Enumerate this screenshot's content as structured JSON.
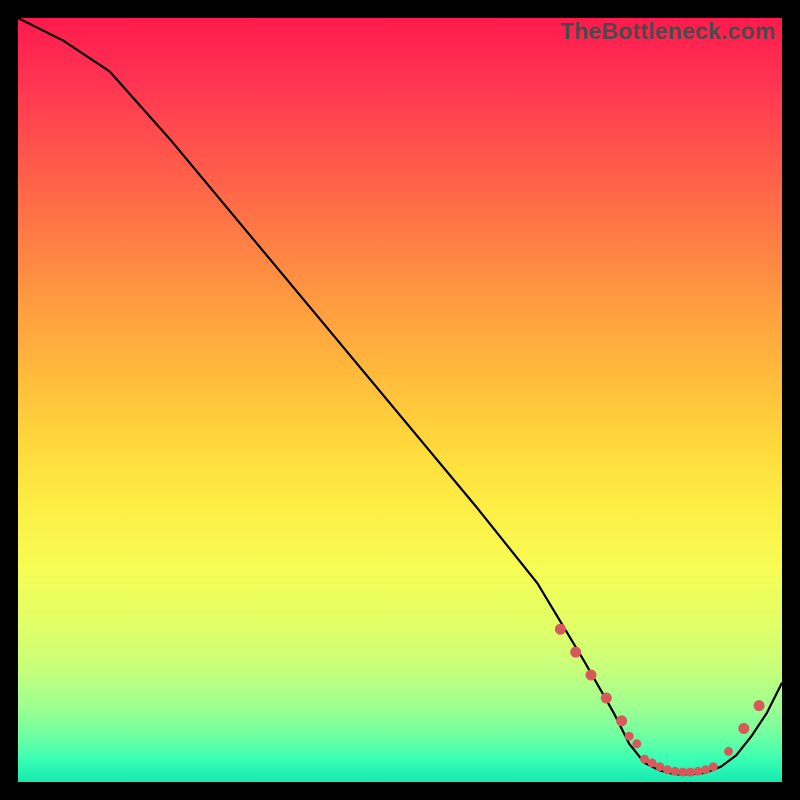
{
  "watermark": "TheBottleneck.com",
  "chart_data": {
    "type": "line",
    "title": "",
    "xlabel": "",
    "ylabel": "",
    "xlim": [
      0,
      100
    ],
    "ylim": [
      0,
      100
    ],
    "series": [
      {
        "name": "curve",
        "x": [
          0,
          6,
          12,
          20,
          30,
          40,
          50,
          60,
          68,
          74,
          78,
          80,
          82,
          84,
          86,
          88,
          90,
          92,
          94,
          96,
          98,
          100
        ],
        "y": [
          100,
          97,
          93,
          84,
          72,
          60,
          48,
          36,
          26,
          16,
          9,
          5,
          2.5,
          1.5,
          1,
          1,
          1.2,
          2,
          3.5,
          6,
          9,
          13
        ]
      }
    ],
    "highlight_dots": {
      "name": "optimal-range",
      "x": [
        71,
        73,
        75,
        77,
        79,
        80,
        81,
        82,
        83,
        84,
        85,
        86,
        87,
        88,
        89,
        90,
        91,
        93,
        95,
        97
      ],
      "y": [
        20,
        17,
        14,
        11,
        8,
        6,
        5,
        3,
        2.5,
        2,
        1.6,
        1.4,
        1.3,
        1.3,
        1.4,
        1.6,
        2,
        4,
        7,
        10
      ]
    },
    "background": {
      "gradient": "red-yellow-green (top-to-bottom)",
      "meaning": "red=high bottleneck, green=optimal"
    }
  }
}
